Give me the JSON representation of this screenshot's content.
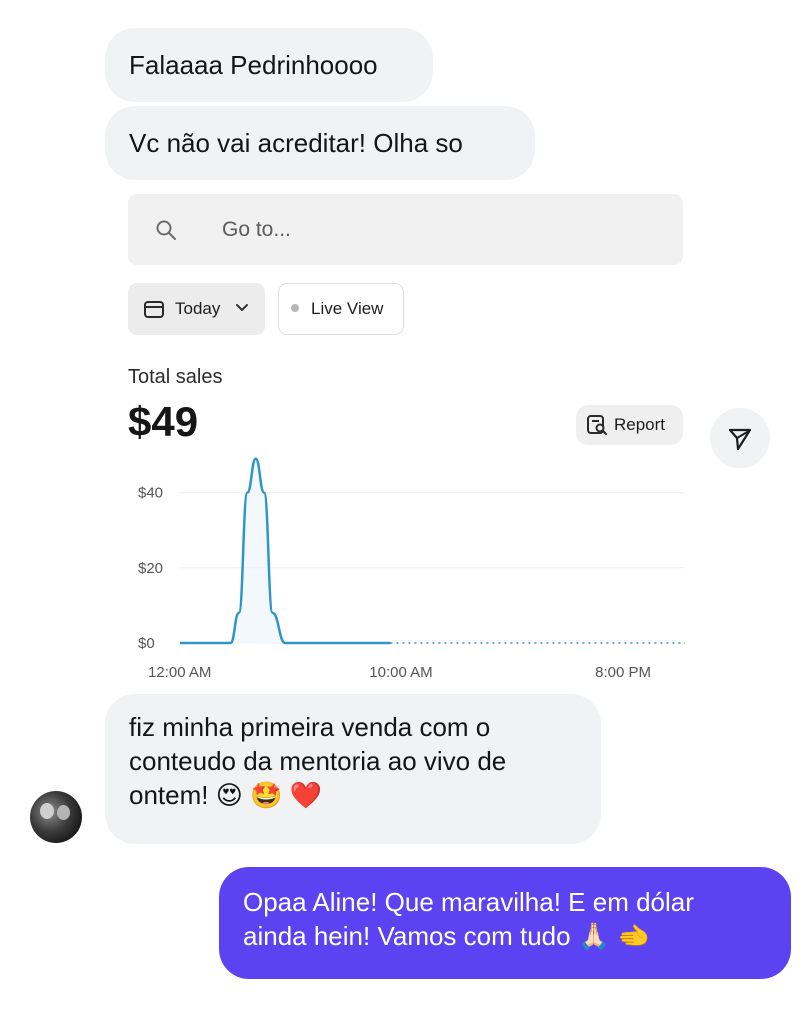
{
  "messages": {
    "incoming": [
      {
        "text": "Falaaaa Pedrinhoooo"
      },
      {
        "text": "Vc não vai acreditar! Olha so"
      }
    ],
    "incoming_with_emoji": {
      "lines": [
        "fiz minha primeira venda com o",
        "conteudo da mentoria ao vivo de",
        "ontem!"
      ],
      "emojis": [
        "😍",
        "🤩",
        "❤️"
      ]
    },
    "outgoing": {
      "lines": [
        "Opaa Aline! Que maravilha! E em dólar",
        "ainda hein! Vamos com tudo"
      ],
      "emojis": [
        "🙏🏻",
        "🫲"
      ]
    }
  },
  "screenshot_card": {
    "search": {
      "placeholder": "Go to...",
      "icon": "search-icon"
    },
    "filters": {
      "date_label": "Today",
      "date_icon": "calendar-icon",
      "live_label": "Live View"
    },
    "metric": {
      "label": "Total sales",
      "value": "$49"
    },
    "report_button": {
      "label": "Report",
      "icon": "report-icon"
    },
    "accent_color": "#2f95c8"
  },
  "chart_data": {
    "type": "line",
    "title": "",
    "xlabel": "",
    "ylabel": "",
    "y_ticks": [
      "$0",
      "$20",
      "$40"
    ],
    "x_ticks": [
      "12:00 AM",
      "10:00 AM",
      "8:00 PM"
    ],
    "ylim": [
      0,
      50
    ],
    "xlim": [
      0,
      24
    ],
    "x": [
      0,
      1,
      2,
      2.4,
      2.8,
      3.2,
      3.6,
      4.0,
      4.4,
      5,
      6,
      7,
      8,
      9,
      10
    ],
    "y": [
      0,
      0,
      0,
      0,
      8,
      40,
      49,
      40,
      8,
      0,
      0,
      0,
      0,
      0,
      0
    ],
    "projection_range": [
      10,
      24
    ],
    "grid": true,
    "legend": "none"
  },
  "send_button": {
    "icon": "send-icon"
  },
  "avatar": {
    "icon": "avatar"
  }
}
